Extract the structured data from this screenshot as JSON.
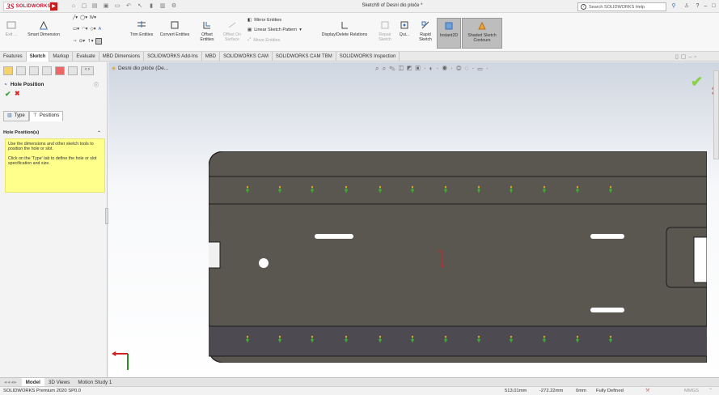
{
  "app": {
    "logo_text": "SOLIDWORKS",
    "doc_title": "Sketch9 of Desni dio ploče *",
    "help_search_placeholder": "Search SOLIDWORKS Help",
    "window_controls": [
      "?",
      "–",
      "□"
    ]
  },
  "ribbon": {
    "exit_label": "Exit ...",
    "smart_dimension": "Smart Dimension",
    "trim_entities": "Trim Entities",
    "convert_entities": "Convert Entities",
    "offset_entities": "Offset Entities",
    "offset_on_surface": "Offset On Surface",
    "mirror_entities": "Mirror Entities",
    "linear_pattern": "Linear Sketch Pattern",
    "move_entities": "Move Entities",
    "display_delete_relations": "Display/Delete Relations",
    "repair_sketch": "Repair Sketch",
    "quick_snaps": "Qui...",
    "rapid_sketch": "Rapid Sketch",
    "instant2d": "Instant2D",
    "shaded_contours": "Shaded Sketch Contours"
  },
  "tabs": [
    "Features",
    "Sketch",
    "Markup",
    "Evaluate",
    "MBD Dimensions",
    "SOLIDWORKS Add-Ins",
    "MBD",
    "SOLIDWORKS CAM",
    "SOLIDWORKS CAM TBM",
    "SOLIDWORKS Inspection"
  ],
  "active_tab": "Sketch",
  "property_manager": {
    "title": "Hole Position",
    "subtabs": [
      "Type",
      "Positions"
    ],
    "group_title": "Hole Position(s)",
    "hint_p1": "Use the dimensions and other sketch tools to position the hole or slot.",
    "hint_p2": "Click on the 'Type' tab to define the hole or slot specification and size."
  },
  "viewport": {
    "tree_item": "Desni dio ploče (De..."
  },
  "bottom_tabs": [
    "Model",
    "3D Views",
    "Motion Study 1"
  ],
  "active_bottom_tab": "Model",
  "status": {
    "product": "SOLIDWORKS Premium 2020 SP0.0",
    "x": "513.01mm",
    "y": "-272.22mm",
    "z": "0mm",
    "state": "Fully Defined",
    "units": "MMGS"
  },
  "colors": {
    "part_fill": "#5a5650",
    "part_band": "#4d4a52",
    "part_edge": "#1d1d1d",
    "point_green": "#3dbb2a",
    "hint_bg": "#ffff8c",
    "brand_red": "#d0112b"
  }
}
